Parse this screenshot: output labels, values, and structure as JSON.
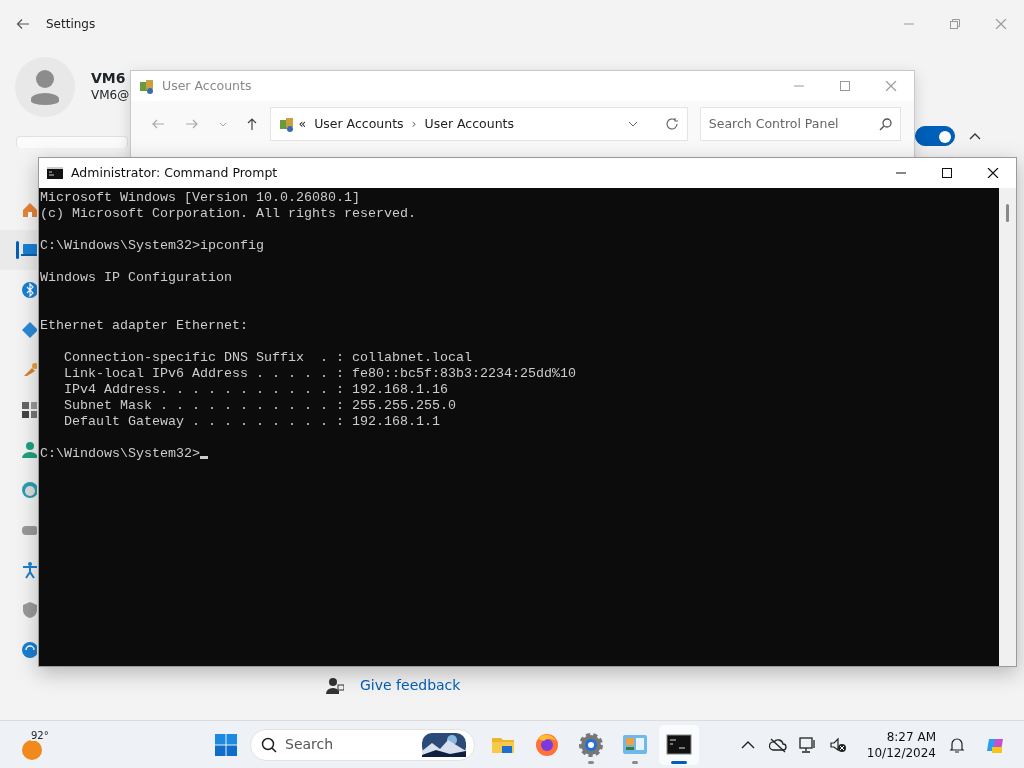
{
  "settings_window": {
    "title": "Settings",
    "user": {
      "name": "VM6",
      "email": "VM6@"
    },
    "nav_items": [
      {
        "kind": "home",
        "selected": false
      },
      {
        "kind": "system",
        "selected": true
      },
      {
        "kind": "bluetooth",
        "selected": false
      },
      {
        "kind": "network",
        "selected": false
      },
      {
        "kind": "personalization",
        "selected": false
      },
      {
        "kind": "apps",
        "selected": false
      },
      {
        "kind": "accounts",
        "selected": false
      },
      {
        "kind": "time",
        "selected": false
      },
      {
        "kind": "gaming",
        "selected": false
      },
      {
        "kind": "accessibility",
        "selected": false
      },
      {
        "kind": "privacy",
        "selected": false
      },
      {
        "kind": "update",
        "selected": false
      }
    ],
    "toggle": {
      "on": true
    },
    "feedback_link": "Give feedback"
  },
  "user_accounts_window": {
    "title": "User Accounts",
    "address": {
      "overflow": "«",
      "separator": "›",
      "items": [
        "User Accounts",
        "User Accounts"
      ]
    },
    "search": {
      "placeholder": "Search Control Panel"
    }
  },
  "command_prompt": {
    "title": "Administrator: Command Prompt",
    "lines": [
      {
        "kind": "text",
        "text": "Microsoft Windows [Version 10.0.26080.1]"
      },
      {
        "kind": "text",
        "text": "(c) Microsoft Corporation. All rights reserved."
      },
      {
        "kind": "blank"
      },
      {
        "kind": "text",
        "text": "C:\\Windows\\System32>ipconfig"
      },
      {
        "kind": "blank"
      },
      {
        "kind": "text",
        "text": "Windows IP Configuration"
      },
      {
        "kind": "blank"
      },
      {
        "kind": "blank"
      },
      {
        "kind": "text",
        "text": "Ethernet adapter Ethernet:"
      },
      {
        "kind": "blank"
      },
      {
        "kind": "text",
        "text": "   Connection-specific DNS Suffix  . : collabnet.local"
      },
      {
        "kind": "text",
        "text": "   Link-local IPv6 Address . . . . . : fe80::bc5f:83b3:2234:25dd%10"
      },
      {
        "kind": "text",
        "text": "   IPv4 Address. . . . . . . . . . . : 192.168.1.16"
      },
      {
        "kind": "text",
        "text": "   Subnet Mask . . . . . . . . . . . : 255.255.255.0"
      },
      {
        "kind": "text",
        "text": "   Default Gateway . . . . . . . . . : 192.168.1.1"
      },
      {
        "kind": "blank"
      },
      {
        "kind": "prompt",
        "text": "C:\\Windows\\System32>"
      }
    ]
  },
  "taskbar": {
    "weather": {
      "temperature": "92°"
    },
    "search": {
      "placeholder": "Search"
    },
    "apps": [
      {
        "kind": "folder",
        "running": false,
        "selected": false
      },
      {
        "kind": "browser",
        "running": false,
        "selected": false
      },
      {
        "kind": "gear",
        "running": true,
        "selected": false
      },
      {
        "kind": "control-panel",
        "running": true,
        "selected": false
      },
      {
        "kind": "terminal",
        "running": true,
        "selected": true
      }
    ],
    "clock": {
      "time": "8:27 AM",
      "date": "10/12/2024"
    }
  }
}
